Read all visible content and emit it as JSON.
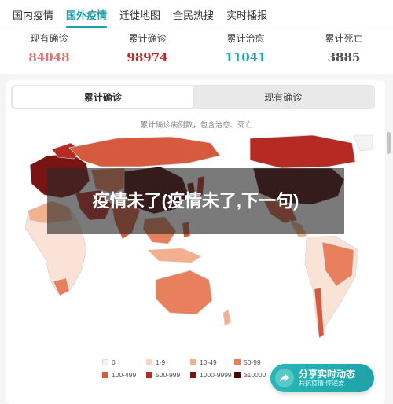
{
  "tabs": [
    {
      "label": "国内疫情",
      "active": false
    },
    {
      "label": "国外疫情",
      "active": true
    },
    {
      "label": "迁徙地图",
      "active": false
    },
    {
      "label": "全民热搜",
      "active": false
    },
    {
      "label": "实时播报",
      "active": false
    }
  ],
  "stats": [
    {
      "label": "现有确诊",
      "value": "84048",
      "color": "#e57373"
    },
    {
      "label": "累计确诊",
      "value": "98974",
      "color": "#c62828"
    },
    {
      "label": "累计治愈",
      "value": "11041",
      "color": "#26a6a9"
    },
    {
      "label": "累计死亡",
      "value": "3885",
      "color": "#555555"
    }
  ],
  "toggle": {
    "option_1": "累计确诊",
    "option_2": "现有确诊",
    "active": "累计确诊"
  },
  "map": {
    "subtitle": "累计确诊病例数，包含治愈、死亡"
  },
  "overlay": {
    "text": "疫情未了(疫情未了,下一句)"
  },
  "legend": [
    {
      "label": "0",
      "color": "#f3f3f3"
    },
    {
      "label": "1-9",
      "color": "#f9d3c6"
    },
    {
      "label": "10-49",
      "color": "#f3b08f"
    },
    {
      "label": "50-99",
      "color": "#e8805e"
    },
    {
      "label": "100-499",
      "color": "#d65a3e"
    },
    {
      "label": "500-999",
      "color": "#b52a23"
    },
    {
      "label": "1000-9999",
      "color": "#7a1414"
    },
    {
      "label": "≥10000",
      "color": "#4a0808"
    }
  ],
  "share": {
    "title": "分享实时动态",
    "subtitle": "共抗疫情 传递爱",
    "icon": "share-arrow-icon"
  }
}
